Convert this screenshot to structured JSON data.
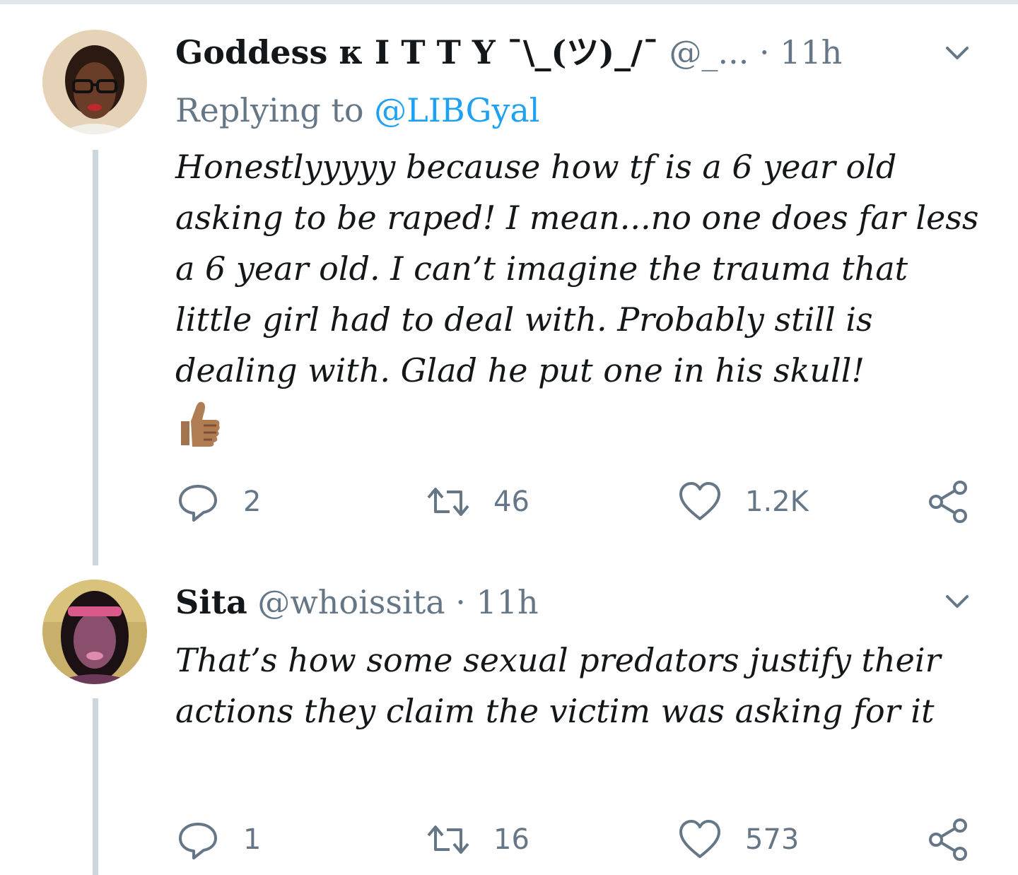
{
  "colors": {
    "text": "#14171a",
    "secondary": "#657786",
    "link": "#1da1f2",
    "thread_line": "#ccd6dd"
  },
  "tweets": [
    {
      "name": "Goddess κ I T T Y ¯\\_(ツ)_/¯",
      "handle": "@_...",
      "separator": "·",
      "time": "11h",
      "replying_prefix": "Replying to",
      "replying_handle": "@LIBGyal",
      "text": "Honestlyyyyy because how tf is a 6 year old asking to be raped! I mean...no one does far less a 6 year old. I can’t imagine the trauma that little girl had to deal with. Probably still is dealing with. Glad he put one in his skull!",
      "emoji": "thumbs-up-medium-skin-tone",
      "replies": "2",
      "retweets": "46",
      "likes": "1.2K"
    },
    {
      "name": "Sita",
      "handle": "@whoissita",
      "separator": "·",
      "time": "11h",
      "text": "That’s how some sexual predators justify their actions they claim the victim was asking for it",
      "replies": "1",
      "retweets": "16",
      "likes": "573"
    }
  ],
  "icons": {
    "reply": "reply-icon",
    "retweet": "retweet-icon",
    "like": "heart-icon",
    "share": "share-icon",
    "more": "chevron-down-icon"
  }
}
